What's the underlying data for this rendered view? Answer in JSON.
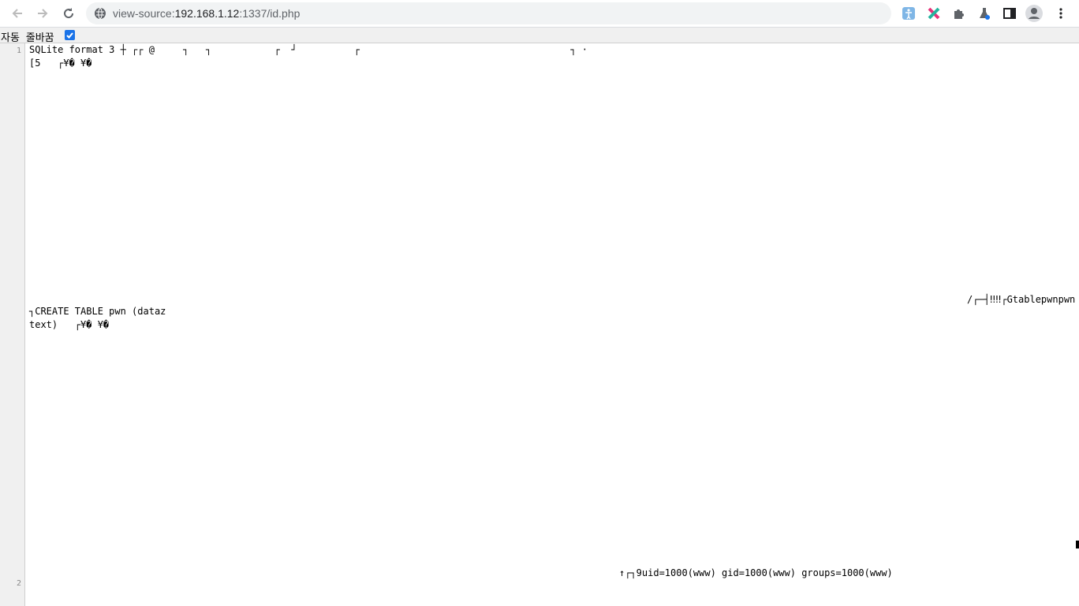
{
  "browser": {
    "url_scheme": "view-source:",
    "url_host": "192.168.1.12",
    "url_path": ":1337/id.php",
    "toolbar_icons": [
      "back-icon",
      "forward-icon",
      "reload-icon",
      "site-info-icon",
      "accessibility-extension-icon",
      "cross-extension-icon",
      "extensions-puzzle-icon",
      "labs-flask-icon",
      "side-panel-icon",
      "profile-avatar-icon",
      "menu-kebab-icon"
    ]
  },
  "viewer": {
    "wrap_label": "자동 줄바꿈",
    "wrap_checked": true,
    "line_numbers": [
      "1",
      "2"
    ]
  },
  "source": {
    "line1_a": "SQLite format 3 ┼ ┌┌ @     ┐   ┐           ┌  ┘          ┌                                     ┐ ·",
    "line1_b": "[5   ┌¥� ¥�",
    "line1_c": "/┌─┤‼‼┌Gtablepwnpwn",
    "line1_d": "┐CREATE TABLE pwn (dataz",
    "line1_e": "text)   ┌¥� ¥�",
    "line1_f": "↑┌┐9uid=1000(www) gid=1000(www) groups=1000(www)"
  }
}
